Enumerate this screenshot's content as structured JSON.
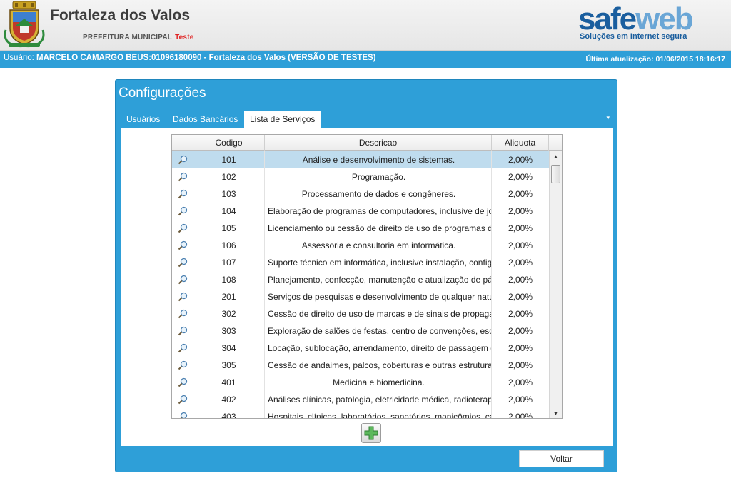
{
  "header": {
    "city_name": "Fortaleza dos Valos",
    "city_subtitle": "PREFEITURA MUNICIPAL",
    "environment": "Teste",
    "brand_part1": "safe",
    "brand_part2": "web",
    "brand_tagline": "Soluções em Internet segura"
  },
  "userbar": {
    "user_label": "Usuário:",
    "user_value": "MARCELO CAMARGO BEUS:01096180090 - Fortaleza dos Valos (VERSÃO DE TESTES)",
    "updated": "Última atualização: 01/06/2015 18:16:17"
  },
  "panel": {
    "title": "Configurações",
    "tabs": [
      {
        "label": "Usuários"
      },
      {
        "label": "Dados Bancários"
      },
      {
        "label": "Lista de Serviços"
      }
    ],
    "active_tab": 2
  },
  "grid": {
    "columns": [
      "Codigo",
      "Descricao",
      "Aliquota"
    ],
    "rows": [
      {
        "code": "101",
        "desc": "Análise e desenvolvimento de sistemas.",
        "aliq": "2,00%"
      },
      {
        "code": "102",
        "desc": "Programação.",
        "aliq": "2,00%"
      },
      {
        "code": "103",
        "desc": "Processamento de dados e congêneres.",
        "aliq": "2,00%"
      },
      {
        "code": "104",
        "desc": "Elaboração de programas de computadores, inclusive de jo",
        "aliq": "2,00%"
      },
      {
        "code": "105",
        "desc": "Licenciamento ou cessão de direito de uso de programas d",
        "aliq": "2,00%"
      },
      {
        "code": "106",
        "desc": "Assessoria e consultoria em informática.",
        "aliq": "2,00%"
      },
      {
        "code": "107",
        "desc": "Suporte técnico em informática, inclusive instalação, config",
        "aliq": "2,00%"
      },
      {
        "code": "108",
        "desc": "Planejamento, confecção, manutenção e atualização de pág",
        "aliq": "2,00%"
      },
      {
        "code": "201",
        "desc": "Serviços de pesquisas e desenvolvimento de qualquer natu",
        "aliq": "2,00%"
      },
      {
        "code": "302",
        "desc": "Cessão de direito de uso de marcas e de sinais de propagar",
        "aliq": "2,00%"
      },
      {
        "code": "303",
        "desc": "Exploração de salões de festas, centro de convenções, escri",
        "aliq": "2,00%"
      },
      {
        "code": "304",
        "desc": "Locação, sublocação, arrendamento, direito de passagem o",
        "aliq": "2,00%"
      },
      {
        "code": "305",
        "desc": "Cessão de andaimes, palcos, coberturas e outras estruturas",
        "aliq": "2,00%"
      },
      {
        "code": "401",
        "desc": "Medicina e biomedicina.",
        "aliq": "2,00%"
      },
      {
        "code": "402",
        "desc": "Análises clínicas, patologia, eletricidade médica, radioterapi",
        "aliq": "2,00%"
      },
      {
        "code": "403",
        "desc": "Hospitais, clínicas, laboratórios, sanatórios, manicômios, cas",
        "aliq": "2,00%"
      }
    ],
    "selected_row": 0
  },
  "footer": {
    "back_label": "Voltar"
  },
  "colors": {
    "accent": "#2e9fd8",
    "selected_row": "#bfdcee",
    "environment": "#e02020"
  },
  "icons": {
    "row_icon": "magnifier-icon",
    "add_icon": "plus-icon",
    "crest": "coat-of-arms-icon"
  }
}
